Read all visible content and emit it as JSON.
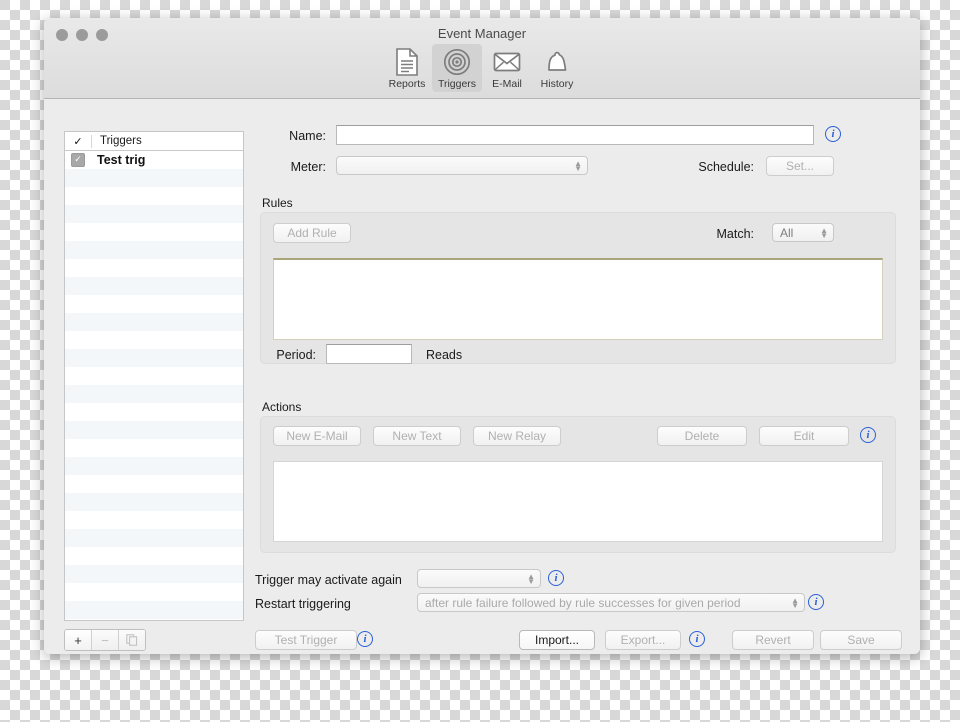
{
  "window": {
    "title": "Event Manager",
    "traffic_lights": [
      "close-button",
      "minimize-button",
      "zoom-button"
    ]
  },
  "toolbar": {
    "items": [
      {
        "label": "Reports",
        "icon": "document-icon",
        "selected": false
      },
      {
        "label": "Triggers",
        "icon": "target-icon",
        "selected": true
      },
      {
        "label": "E-Mail",
        "icon": "envelope-icon",
        "selected": false
      },
      {
        "label": "History",
        "icon": "bell-icon",
        "selected": false
      }
    ]
  },
  "sidebar": {
    "header": {
      "check": "✓",
      "title": "Triggers"
    },
    "rows": [
      {
        "label": "Test trig",
        "checked": true
      }
    ],
    "controls": [
      {
        "name": "add-button",
        "glyph": "+",
        "enabled": true
      },
      {
        "name": "remove-button",
        "glyph": "−",
        "enabled": false
      },
      {
        "name": "duplicate-button",
        "glyph": "⧉",
        "enabled": false
      }
    ]
  },
  "form": {
    "name_label": "Name:",
    "name_value": "",
    "meter_label": "Meter:",
    "meter_value": "",
    "schedule_label": "Schedule:",
    "schedule_button": "Set..."
  },
  "rules": {
    "group_title": "Rules",
    "add_rule_button": "Add Rule",
    "match_label": "Match:",
    "match_value": "All",
    "period_label": "Period:",
    "period_value": "",
    "reads_label": "Reads",
    "items": []
  },
  "actions": {
    "group_title": "Actions",
    "new_email_button": "New E-Mail",
    "new_text_button": "New Text",
    "new_relay_button": "New Relay",
    "delete_button": "Delete",
    "edit_button": "Edit",
    "items": []
  },
  "trigger_options": {
    "activate_again_label": "Trigger may activate again",
    "activate_again_value": "",
    "restart_label": "Restart triggering",
    "restart_value": "after rule failure followed by rule successes for given period"
  },
  "footer": {
    "test_trigger_button": "Test Trigger",
    "import_button": "Import...",
    "export_button": "Export...",
    "revert_button": "Revert",
    "save_button": "Save"
  },
  "colors": {
    "accent": "#2b5fd9",
    "window_bg": "#ececec",
    "group_bg": "#e5e5e5",
    "rules_border": "#a9a578"
  }
}
